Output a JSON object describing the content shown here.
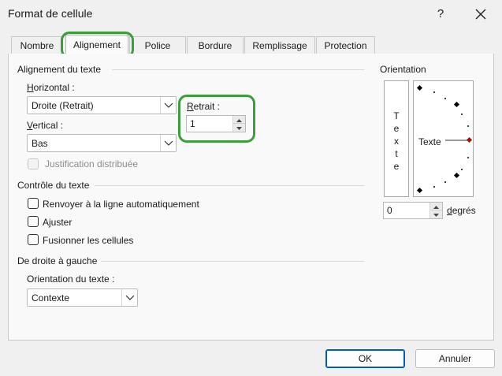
{
  "window": {
    "title": "Format de cellule",
    "help_label": "?"
  },
  "tabs": [
    {
      "label": "Nombre"
    },
    {
      "label": "Alignement"
    },
    {
      "label": "Police"
    },
    {
      "label": "Bordure"
    },
    {
      "label": "Remplissage"
    },
    {
      "label": "Protection"
    }
  ],
  "text_alignment": {
    "section_title": "Alignement du texte",
    "horizontal_label": "Horizontal :",
    "horizontal_value": "Droite (Retrait)",
    "vertical_label": "Vertical :",
    "vertical_value": "Bas",
    "indent_label": "Retrait :",
    "indent_value": "1",
    "justify_distributed_label": "Justification distribuée"
  },
  "text_control": {
    "section_title": "Contrôle du texte",
    "wrap_label": "Renvoyer à la ligne automatiquement",
    "shrink_label": "Ajuster",
    "merge_label": "Fusionner les cellules"
  },
  "rtl": {
    "section_title": "De droite à gauche",
    "direction_label": "Orientation du texte :",
    "direction_value": "Contexte"
  },
  "orientation": {
    "title": "Orientation",
    "vertical_letters": [
      "T",
      "e",
      "x",
      "t",
      "e"
    ],
    "dial_text": "Texte",
    "degrees_value": "0",
    "degrees_label": "degrés"
  },
  "footer": {
    "ok_label": "OK",
    "cancel_label": "Annuler"
  },
  "colors": {
    "highlight_ring": "#3a9e3a",
    "default_button_border": "#005fb8",
    "dial_marker": "#c00000"
  }
}
